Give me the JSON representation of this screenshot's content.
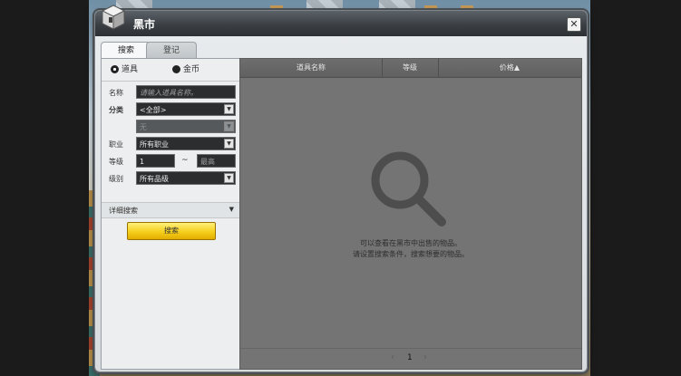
{
  "window": {
    "title": "黑市",
    "close_label": "✕"
  },
  "tabs": [
    {
      "label": "搜索",
      "active": true
    },
    {
      "label": "登记",
      "active": false
    }
  ],
  "search_type": {
    "item_label": "道具",
    "gold_label": "金币",
    "selected": "item"
  },
  "filters": {
    "name_label": "名称",
    "name_placeholder": "请输入道具名称。",
    "category_label": "分类",
    "category_value": "<全部>",
    "subcategory_value": "无",
    "job_label": "职业",
    "job_value": "所有职业",
    "level_label": "等级",
    "level_min": "1",
    "level_sep": "~",
    "level_max_placeholder": "最高",
    "grade_label": "级别",
    "grade_value": "所有品级"
  },
  "detail_search": {
    "label": "详细搜索",
    "toggle": "▼"
  },
  "search_button_label": "搜索",
  "results": {
    "columns": [
      "道具名称",
      "等级",
      "价格▲"
    ],
    "empty_line1": "可以查看在黑市中出售的物品。",
    "empty_line2": "请设置搜索条件，搜索想要的物品。",
    "page": "1",
    "prev": "‹",
    "next": "›"
  },
  "colors": {
    "accent": "#f6cf1c",
    "panel": "#747474",
    "titlebar": "#3a3f44"
  }
}
